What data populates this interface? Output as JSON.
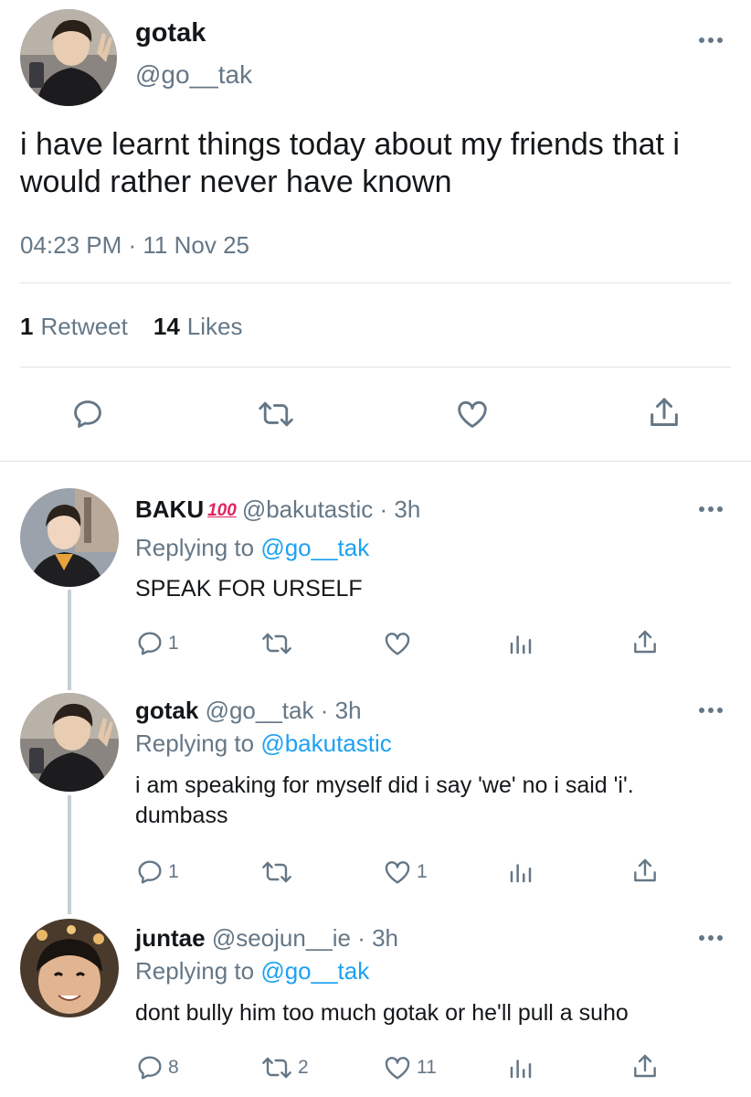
{
  "main_tweet": {
    "author_name": "gotak",
    "author_handle": "@go__tak",
    "text": "i have learnt things today about my friends that i would rather never have known",
    "timestamp": "04:23 PM · 11 Nov 25",
    "retweets_count": "1",
    "retweets_label": "Retweet",
    "likes_count": "14",
    "likes_label": "Likes",
    "actions": [
      "reply-icon",
      "retweet-icon",
      "like-icon",
      "share-icon"
    ]
  },
  "replies": [
    {
      "author_name": "BAKU",
      "badge": "💯",
      "author_handle": "@bakutastic",
      "time": "· 3h",
      "replying_prefix": "Replying to",
      "replying_to": "@go__tak",
      "text": "SPEAK FOR URSELF",
      "reply_count": "1",
      "retweet_count": "",
      "like_count": ""
    },
    {
      "author_name": "gotak",
      "author_handle": "@go__tak",
      "time": "· 3h",
      "replying_prefix": "Replying to",
      "replying_to": "@bakutastic",
      "text": "i am speaking for myself did i say 'we' no i said 'i'. dumbass",
      "reply_count": "1",
      "retweet_count": "",
      "like_count": "1"
    },
    {
      "author_name": "juntae",
      "author_handle": "@seojun__ie",
      "time": "· 3h",
      "replying_prefix": "Replying to",
      "replying_to": "@go__tak",
      "text": "dont bully him too much gotak or he'll pull a suho",
      "reply_count": "8",
      "retweet_count": "2",
      "like_count": "11"
    }
  ],
  "colors": {
    "text": "#14171a",
    "secondary": "#657786",
    "link": "#1da1f2",
    "divider": "#dfe3e7",
    "thread_line": "#c4cfd6"
  }
}
